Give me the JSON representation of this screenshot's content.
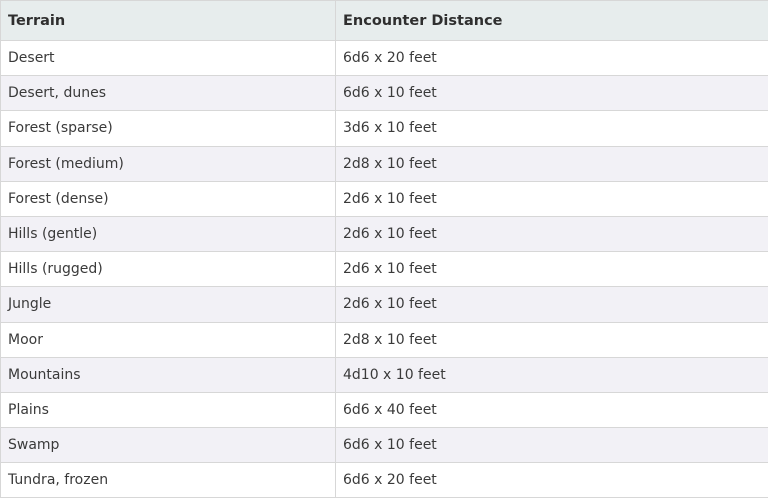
{
  "table": {
    "headers": [
      "Terrain",
      "Encounter Distance"
    ],
    "rows": [
      [
        "Desert",
        "6d6 x 20 feet"
      ],
      [
        "Desert, dunes",
        "6d6 x 10 feet"
      ],
      [
        "Forest (sparse)",
        "3d6 x 10 feet"
      ],
      [
        "Forest (medium)",
        "2d8 x 10 feet"
      ],
      [
        "Forest (dense)",
        "2d6 x 10 feet"
      ],
      [
        "Hills (gentle)",
        "2d6 x 10 feet"
      ],
      [
        "Hills (rugged)",
        "2d6 x 10 feet"
      ],
      [
        "Jungle",
        "2d6 x 10 feet"
      ],
      [
        "Moor",
        "2d8 x 10 feet"
      ],
      [
        "Mountains",
        "4d10 x 10 feet"
      ],
      [
        "Plains",
        "6d6 x 40 feet"
      ],
      [
        "Swamp",
        "6d6 x 10 feet"
      ],
      [
        "Tundra, frozen",
        "6d6 x 20 feet"
      ]
    ]
  }
}
